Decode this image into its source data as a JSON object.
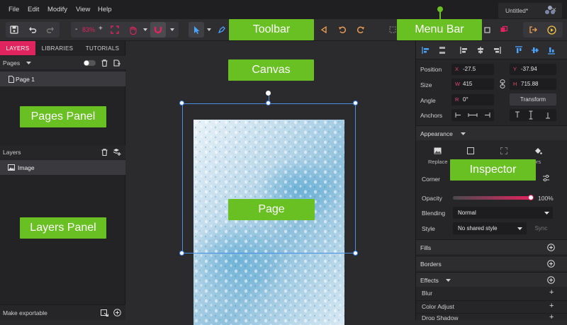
{
  "menu": {
    "items": [
      "File",
      "Edit",
      "Modify",
      "View",
      "Help"
    ]
  },
  "document_tab": {
    "title": "Untitled*",
    "close": "✕"
  },
  "toolbar": {
    "zoom": "83%",
    "minus": "-",
    "plus": "+"
  },
  "left_panel": {
    "tabs": [
      "LAYERS",
      "LIBRARIES",
      "TUTORIALS"
    ],
    "active_tab": "LAYERS",
    "pages_header": "Pages",
    "pages": [
      "Page 1"
    ],
    "layers_header": "Layers",
    "layers": [
      "Image"
    ],
    "footer": "Make exportable"
  },
  "inspector": {
    "position_label": "Position",
    "x_label": "X",
    "x_value": "-27.5",
    "y_label": "Y",
    "y_value": "-37.94",
    "size_label": "Size",
    "w_label": "W",
    "w_value": "415",
    "h_label": "H",
    "h_value": "715.88",
    "angle_label": "Angle",
    "r_label": "R",
    "angle_value": "0°",
    "transform_button": "Transform",
    "anchors_label": "Anchors",
    "appearance_header": "Appearance",
    "replace_label": "Replace",
    "colors_label": "lors",
    "corner_label": "Corner",
    "opacity_label": "Opacity",
    "opacity_value": "100%",
    "opacity_fraction": 1.0,
    "blending_label": "Blending",
    "blending_value": "Normal",
    "style_label": "Style",
    "style_value": "No shared style",
    "sync_button": "Sync",
    "fills": "Fills",
    "borders": "Borders",
    "effects": "Effects",
    "effect_items": [
      "Blur",
      "Color Adjust",
      "Drop Shadow"
    ]
  },
  "callouts": {
    "toolbar": "Toolbar",
    "menu_bar": "Menu Bar",
    "canvas": "Canvas",
    "pages_panel": "Pages Panel",
    "inspector": "Inspector",
    "page": "Page",
    "layers_panel": "Layers Panel"
  },
  "colors": {
    "accent": "#e0245e",
    "callout": "#69c022",
    "selection": "#3b82f6"
  }
}
